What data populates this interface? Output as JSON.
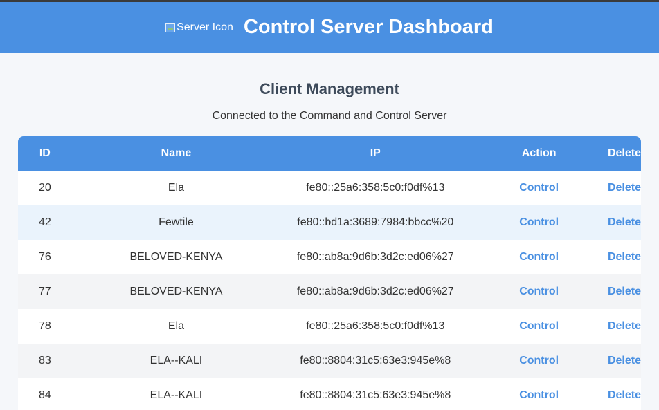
{
  "header": {
    "icon_alt": "Server Icon",
    "title": "Control Server Dashboard"
  },
  "main": {
    "section_title": "Client Management",
    "subtitle": "Connected to the Command and Control Server"
  },
  "table": {
    "columns": [
      "ID",
      "Name",
      "IP",
      "Action",
      "Delete"
    ],
    "rows": [
      {
        "id": "20",
        "name": "Ela",
        "ip": "fe80::25a6:358:5c0:f0df%13",
        "action": "Control",
        "delete": "Delete"
      },
      {
        "id": "42",
        "name": "Fewtile",
        "ip": "fe80::bd1a:3689:7984:bbcc%20",
        "action": "Control",
        "delete": "Delete"
      },
      {
        "id": "76",
        "name": "BELOVED-KENYA",
        "ip": "fe80::ab8a:9d6b:3d2c:ed06%27",
        "action": "Control",
        "delete": "Delete"
      },
      {
        "id": "77",
        "name": "BELOVED-KENYA",
        "ip": "fe80::ab8a:9d6b:3d2c:ed06%27",
        "action": "Control",
        "delete": "Delete"
      },
      {
        "id": "78",
        "name": "Ela",
        "ip": "fe80::25a6:358:5c0:f0df%13",
        "action": "Control",
        "delete": "Delete"
      },
      {
        "id": "83",
        "name": "ELA--KALI",
        "ip": "fe80::8804:31c5:63e3:945e%8",
        "action": "Control",
        "delete": "Delete"
      },
      {
        "id": "84",
        "name": "ELA--KALI",
        "ip": "fe80::8804:31c5:63e3:945e%8",
        "action": "Control",
        "delete": "Delete"
      }
    ]
  },
  "colors": {
    "header_bg": "#4a90e2",
    "link": "#4a90e2",
    "row_alt_blue": "#eaf3fc",
    "row_alt_gray": "#f3f4f6"
  }
}
